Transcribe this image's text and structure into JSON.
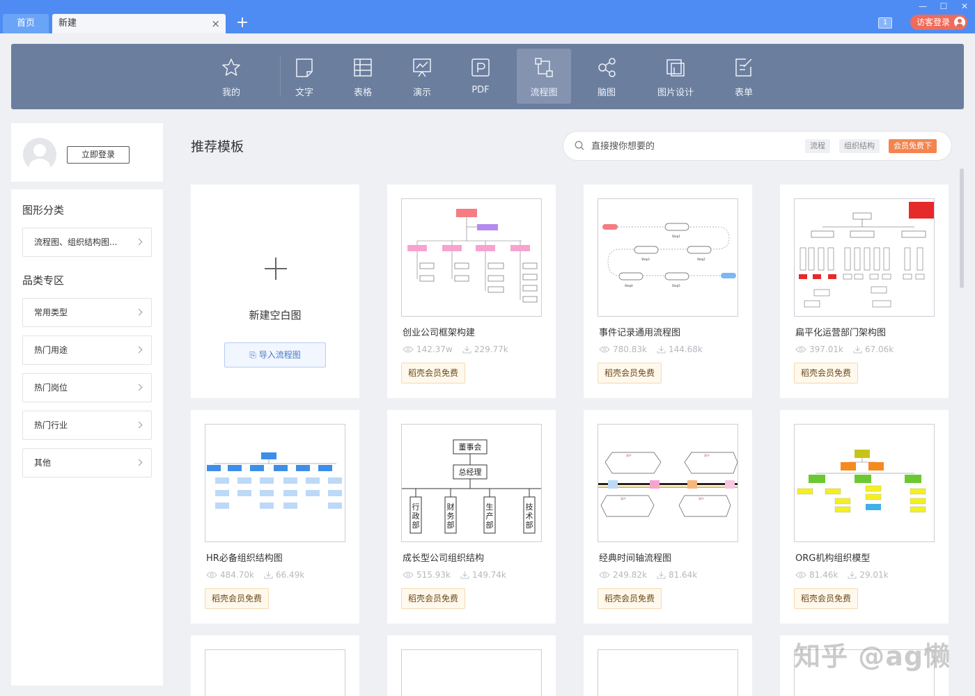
{
  "tabs": {
    "home": "首页",
    "new": "新建",
    "close": "×",
    "add": "+"
  },
  "window": {
    "minimize": "—",
    "maximize": "☐",
    "close": "✕",
    "badge": "1",
    "visitor": "访客登录"
  },
  "categories": [
    {
      "label": "我的",
      "icon": "star-icon"
    },
    {
      "label": "文字",
      "icon": "document-icon"
    },
    {
      "label": "表格",
      "icon": "table-icon"
    },
    {
      "label": "演示",
      "icon": "presentation-icon"
    },
    {
      "label": "PDF",
      "icon": "pdf-icon"
    },
    {
      "label": "流程图",
      "icon": "flowchart-icon",
      "active": true
    },
    {
      "label": "脑图",
      "icon": "mindmap-icon"
    },
    {
      "label": "图片设计",
      "icon": "image-design-icon"
    },
    {
      "label": "表单",
      "icon": "form-icon"
    }
  ],
  "sidebar": {
    "login_label": "立即登录",
    "shape_heading": "图形分类",
    "shape_item": "流程图、组织结构图...",
    "category_heading": "品类专区",
    "items": [
      "常用类型",
      "热门用途",
      "热门岗位",
      "热门行业",
      "其他"
    ]
  },
  "main": {
    "title": "推荐模板",
    "search": {
      "placeholder": "直接搜你想要的",
      "tags": [
        "流程",
        "组织结构",
        "会员免费下"
      ]
    },
    "new_card": {
      "label": "新建空白图",
      "import_label": "导入流程图"
    },
    "badge_label": "稻壳会员免费",
    "templates": [
      {
        "title": "创业公司框架构建",
        "views": "142.37w",
        "downloads": "229.77k"
      },
      {
        "title": "事件记录通用流程图",
        "views": "780.83k",
        "downloads": "144.68k"
      },
      {
        "title": "扁平化运营部门架构图",
        "views": "397.01k",
        "downloads": "67.06k"
      },
      {
        "title": "HR必备组织结构图",
        "views": "484.70k",
        "downloads": "66.49k"
      },
      {
        "title": "成长型公司组织结构",
        "views": "515.93k",
        "downloads": "149.74k"
      },
      {
        "title": "经典时间轴流程图",
        "views": "249.82k",
        "downloads": "81.64k"
      },
      {
        "title": "ORG机构组织模型",
        "views": "81.46k",
        "downloads": "29.01k"
      }
    ],
    "growth_chart": {
      "top": "董事会",
      "second": "总经理",
      "depts": [
        "行政部",
        "财务部",
        "生产部",
        "技术部"
      ]
    }
  },
  "watermark": "知乎 @ag懒",
  "colors": {
    "titlebar": "#4e8cf3",
    "catbar": "#6b7e9e",
    "vip_tag": "#f4844f",
    "visitor": "#ef6b5b"
  }
}
